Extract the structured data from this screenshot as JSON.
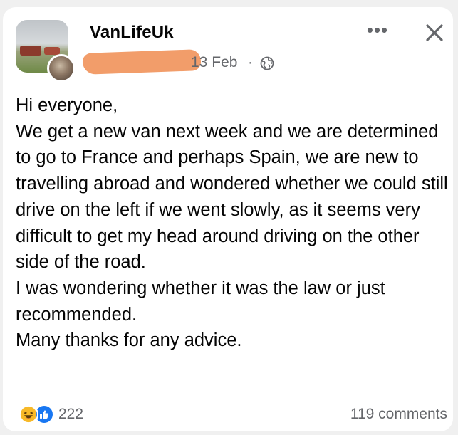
{
  "post": {
    "group_name": "VanLifeUk",
    "date": "13 Feb",
    "separator": "·",
    "audience_icon": "globe-icon",
    "body": "Hi everyone,\nWe get a new van next week and we are determined to go to France and perhaps Spain, we are new to travelling abroad and wondered whether we could still drive on the left if we went slowly, as it seems very difficult to get my head around driving on the other side of the road.\nI was wondering whether it was the law or just recommended.\nMany thanks for any advice."
  },
  "header_actions": {
    "more_label": "•••",
    "more_icon": "more-icon",
    "close_icon": "close-icon"
  },
  "footer": {
    "reaction_icons": [
      "haha-reaction-icon",
      "like-reaction-icon"
    ],
    "reaction_count": "222",
    "comments_label": "119 comments"
  },
  "colors": {
    "text_primary": "#050505",
    "text_secondary": "#65676b",
    "like_blue": "#1877f2",
    "haha_yellow": "#f7b928",
    "redaction_orange": "#f29d6a"
  }
}
